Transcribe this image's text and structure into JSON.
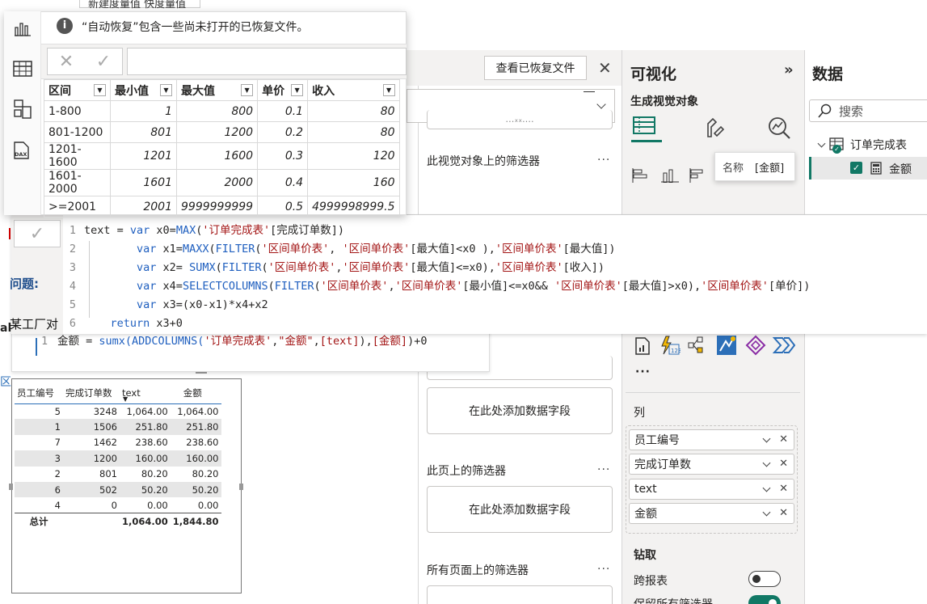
{
  "top_clip": "新建度量值 快度量值",
  "recovery": {
    "message": "“自动恢复”包含一些尚未打开的已恢复文件。",
    "view_button": "查看已恢复文件"
  },
  "grid": {
    "columns": [
      "区间",
      "最小值",
      "最大值",
      "单价",
      "收入"
    ],
    "rows": [
      [
        "1-800",
        "1",
        "800",
        "0.1",
        "80"
      ],
      [
        "801-1200",
        "801",
        "1200",
        "0.2",
        "80"
      ],
      [
        "1201-1600",
        "1201",
        "1600",
        "0.3",
        "120"
      ],
      [
        "1601-2000",
        "1601",
        "2000",
        "0.4",
        "160"
      ],
      [
        ">=2001",
        "2001",
        "9999999999",
        "0.5",
        "4999998999.5"
      ]
    ]
  },
  "filters": {
    "clipped_top": "…ₓₓ.…",
    "visual_title": "此视觉对象上的筛选器",
    "add_field": "在此处添加数据字段",
    "page_title": "此页上的筛选器",
    "all_title": "所有页面上的筛选器",
    "dots": "···"
  },
  "viz": {
    "title": "可视化",
    "expand": "»",
    "build": "生成视觉对象",
    "more": "···",
    "columns_label": "列",
    "fields": [
      "员工编号",
      "完成订单数",
      "text",
      "金额"
    ],
    "drill": "钻取",
    "cross_report": "跨报表",
    "keep_filters": "保留所有筛选器",
    "tooltip": {
      "label": "名称",
      "value": "[金额]"
    }
  },
  "data": {
    "title": "数据",
    "search_placeholder": "搜索",
    "table": "订单完成表",
    "field": "金额"
  },
  "code": {
    "line_numbers": [
      "1",
      "2",
      "3",
      "4",
      "5",
      "6"
    ],
    "lines": [
      "text = var x0=MAX('订单完成表'[完成订单数])",
      "        var x1=MAXX(FILTER('区间单价表', '区间单价表'[最大值]<x0 ),'区间单价表'[最大值])",
      "        var x2= SUMX(FILTER('区间单价表','区间单价表'[最大值]<=x0),'区间单价表'[收入])",
      "        var x4=SELECTCOLUMNS(FILTER('区间单价表','区间单价表'[最小值]<=x0&& '区间单价表'[最大值]>x0),'区间单价表'[单价])",
      "        var x3=(x0-x1)*x4+x2",
      "    return x3+0"
    ],
    "measure_line_no": "1",
    "measure": "金额 = sumx(ADDCOLUMNS('订单完成表',\"金额\",[text]),[金额])+0"
  },
  "left_clip": {
    "question": "问题:",
    "factory": "某工厂对",
    "al": "al",
    "qu": "区"
  },
  "matrix": {
    "headers": [
      "员工编号",
      "完成订单数",
      "text",
      "金额"
    ],
    "rows": [
      [
        "5",
        "3248",
        "1,064.00",
        "1,064.00"
      ],
      [
        "1",
        "1506",
        "251.80",
        "251.80"
      ],
      [
        "7",
        "1462",
        "238.60",
        "238.60"
      ],
      [
        "3",
        "1200",
        "160.00",
        "160.00"
      ],
      [
        "2",
        "801",
        "80.20",
        "80.20"
      ],
      [
        "6",
        "502",
        "50.20",
        "50.20"
      ],
      [
        "4",
        "0",
        "0.00",
        "0.00"
      ]
    ],
    "total": [
      "总计",
      "",
      "1,064.00",
      "1,844.80"
    ]
  },
  "colors": {
    "accent_green": "#117865",
    "code_keyword": "#1f5fbf",
    "code_string": "#a31515",
    "matrix_header_line": "#2c6fb8"
  }
}
